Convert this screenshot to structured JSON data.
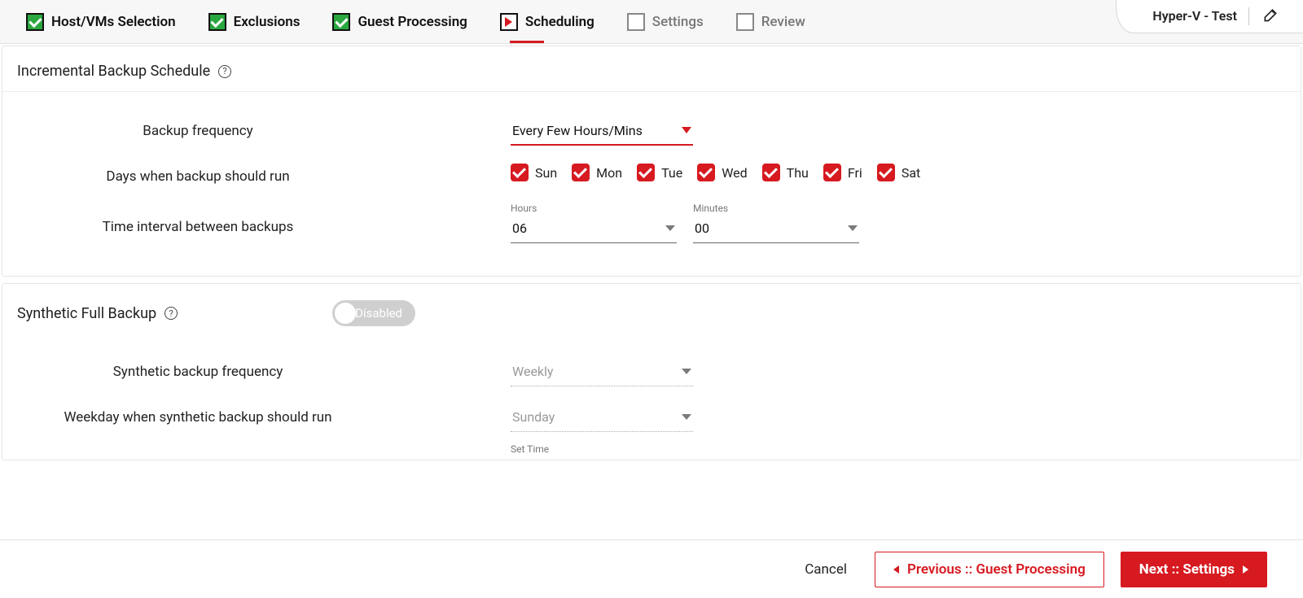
{
  "header": {
    "steps": [
      {
        "label": "Host/VMs Selection",
        "state": "completed"
      },
      {
        "label": "Exclusions",
        "state": "completed"
      },
      {
        "label": "Guest Processing",
        "state": "completed"
      },
      {
        "label": "Scheduling",
        "state": "current"
      },
      {
        "label": "Settings",
        "state": "pending"
      },
      {
        "label": "Review",
        "state": "pending"
      }
    ],
    "right_tab_title": "Hyper-V - Test"
  },
  "section1": {
    "title": "Incremental Backup Schedule",
    "backup_frequency": {
      "label": "Backup frequency",
      "value": "Every Few Hours/Mins"
    },
    "days": {
      "label": "Days when backup should run",
      "items": [
        {
          "label": "Sun",
          "checked": true
        },
        {
          "label": "Mon",
          "checked": true
        },
        {
          "label": "Tue",
          "checked": true
        },
        {
          "label": "Wed",
          "checked": true
        },
        {
          "label": "Thu",
          "checked": true
        },
        {
          "label": "Fri",
          "checked": true
        },
        {
          "label": "Sat",
          "checked": true
        }
      ]
    },
    "interval": {
      "label": "Time interval between backups",
      "hours_label": "Hours",
      "hours_value": "06",
      "minutes_label": "Minutes",
      "minutes_value": "00"
    }
  },
  "section2": {
    "title": "Synthetic Full Backup",
    "toggle": {
      "state_label": "Disabled",
      "enabled": false
    },
    "frequency": {
      "label": "Synthetic backup frequency",
      "value": "Weekly"
    },
    "weekday": {
      "label": "Weekday when synthetic backup should run",
      "value": "Sunday"
    },
    "set_time_label": "Set Time"
  },
  "footer": {
    "cancel_label": "Cancel",
    "prev_label": "Previous :: Guest Processing",
    "next_label": "Next :: Settings"
  }
}
